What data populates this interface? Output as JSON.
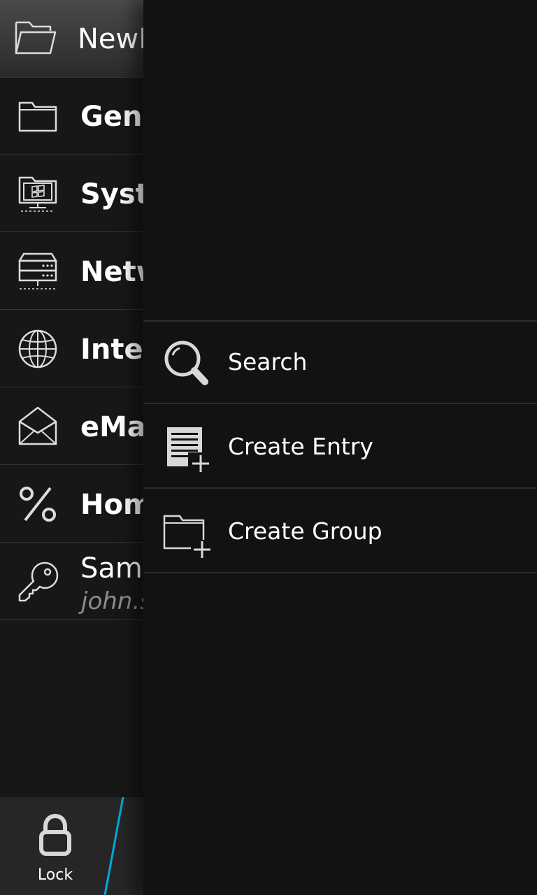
{
  "title_bar": {
    "title": "NewDatabase",
    "icon": "folder-open-icon"
  },
  "groups": [
    {
      "label": "General",
      "icon": "folder-icon"
    },
    {
      "label": "System",
      "icon": "windows-computer-icon"
    },
    {
      "label": "Network",
      "icon": "server-icon"
    },
    {
      "label": "Internet",
      "icon": "globe-icon"
    },
    {
      "label": "eMail",
      "icon": "envelope-icon"
    },
    {
      "label": "Homebanking",
      "icon": "percent-icon"
    }
  ],
  "entry": {
    "label": "Sample Entry",
    "sublabel": "john.smith",
    "icon": "key-icon"
  },
  "action_bar": {
    "lock_label": "Lock",
    "lock_icon": "lock-icon",
    "accent_color": "#00a8df"
  },
  "menu": {
    "items": [
      {
        "label": "Search",
        "icon": "search-icon"
      },
      {
        "label": "Create Entry",
        "icon": "create-entry-icon"
      },
      {
        "label": "Create Group",
        "icon": "create-group-icon"
      }
    ]
  }
}
